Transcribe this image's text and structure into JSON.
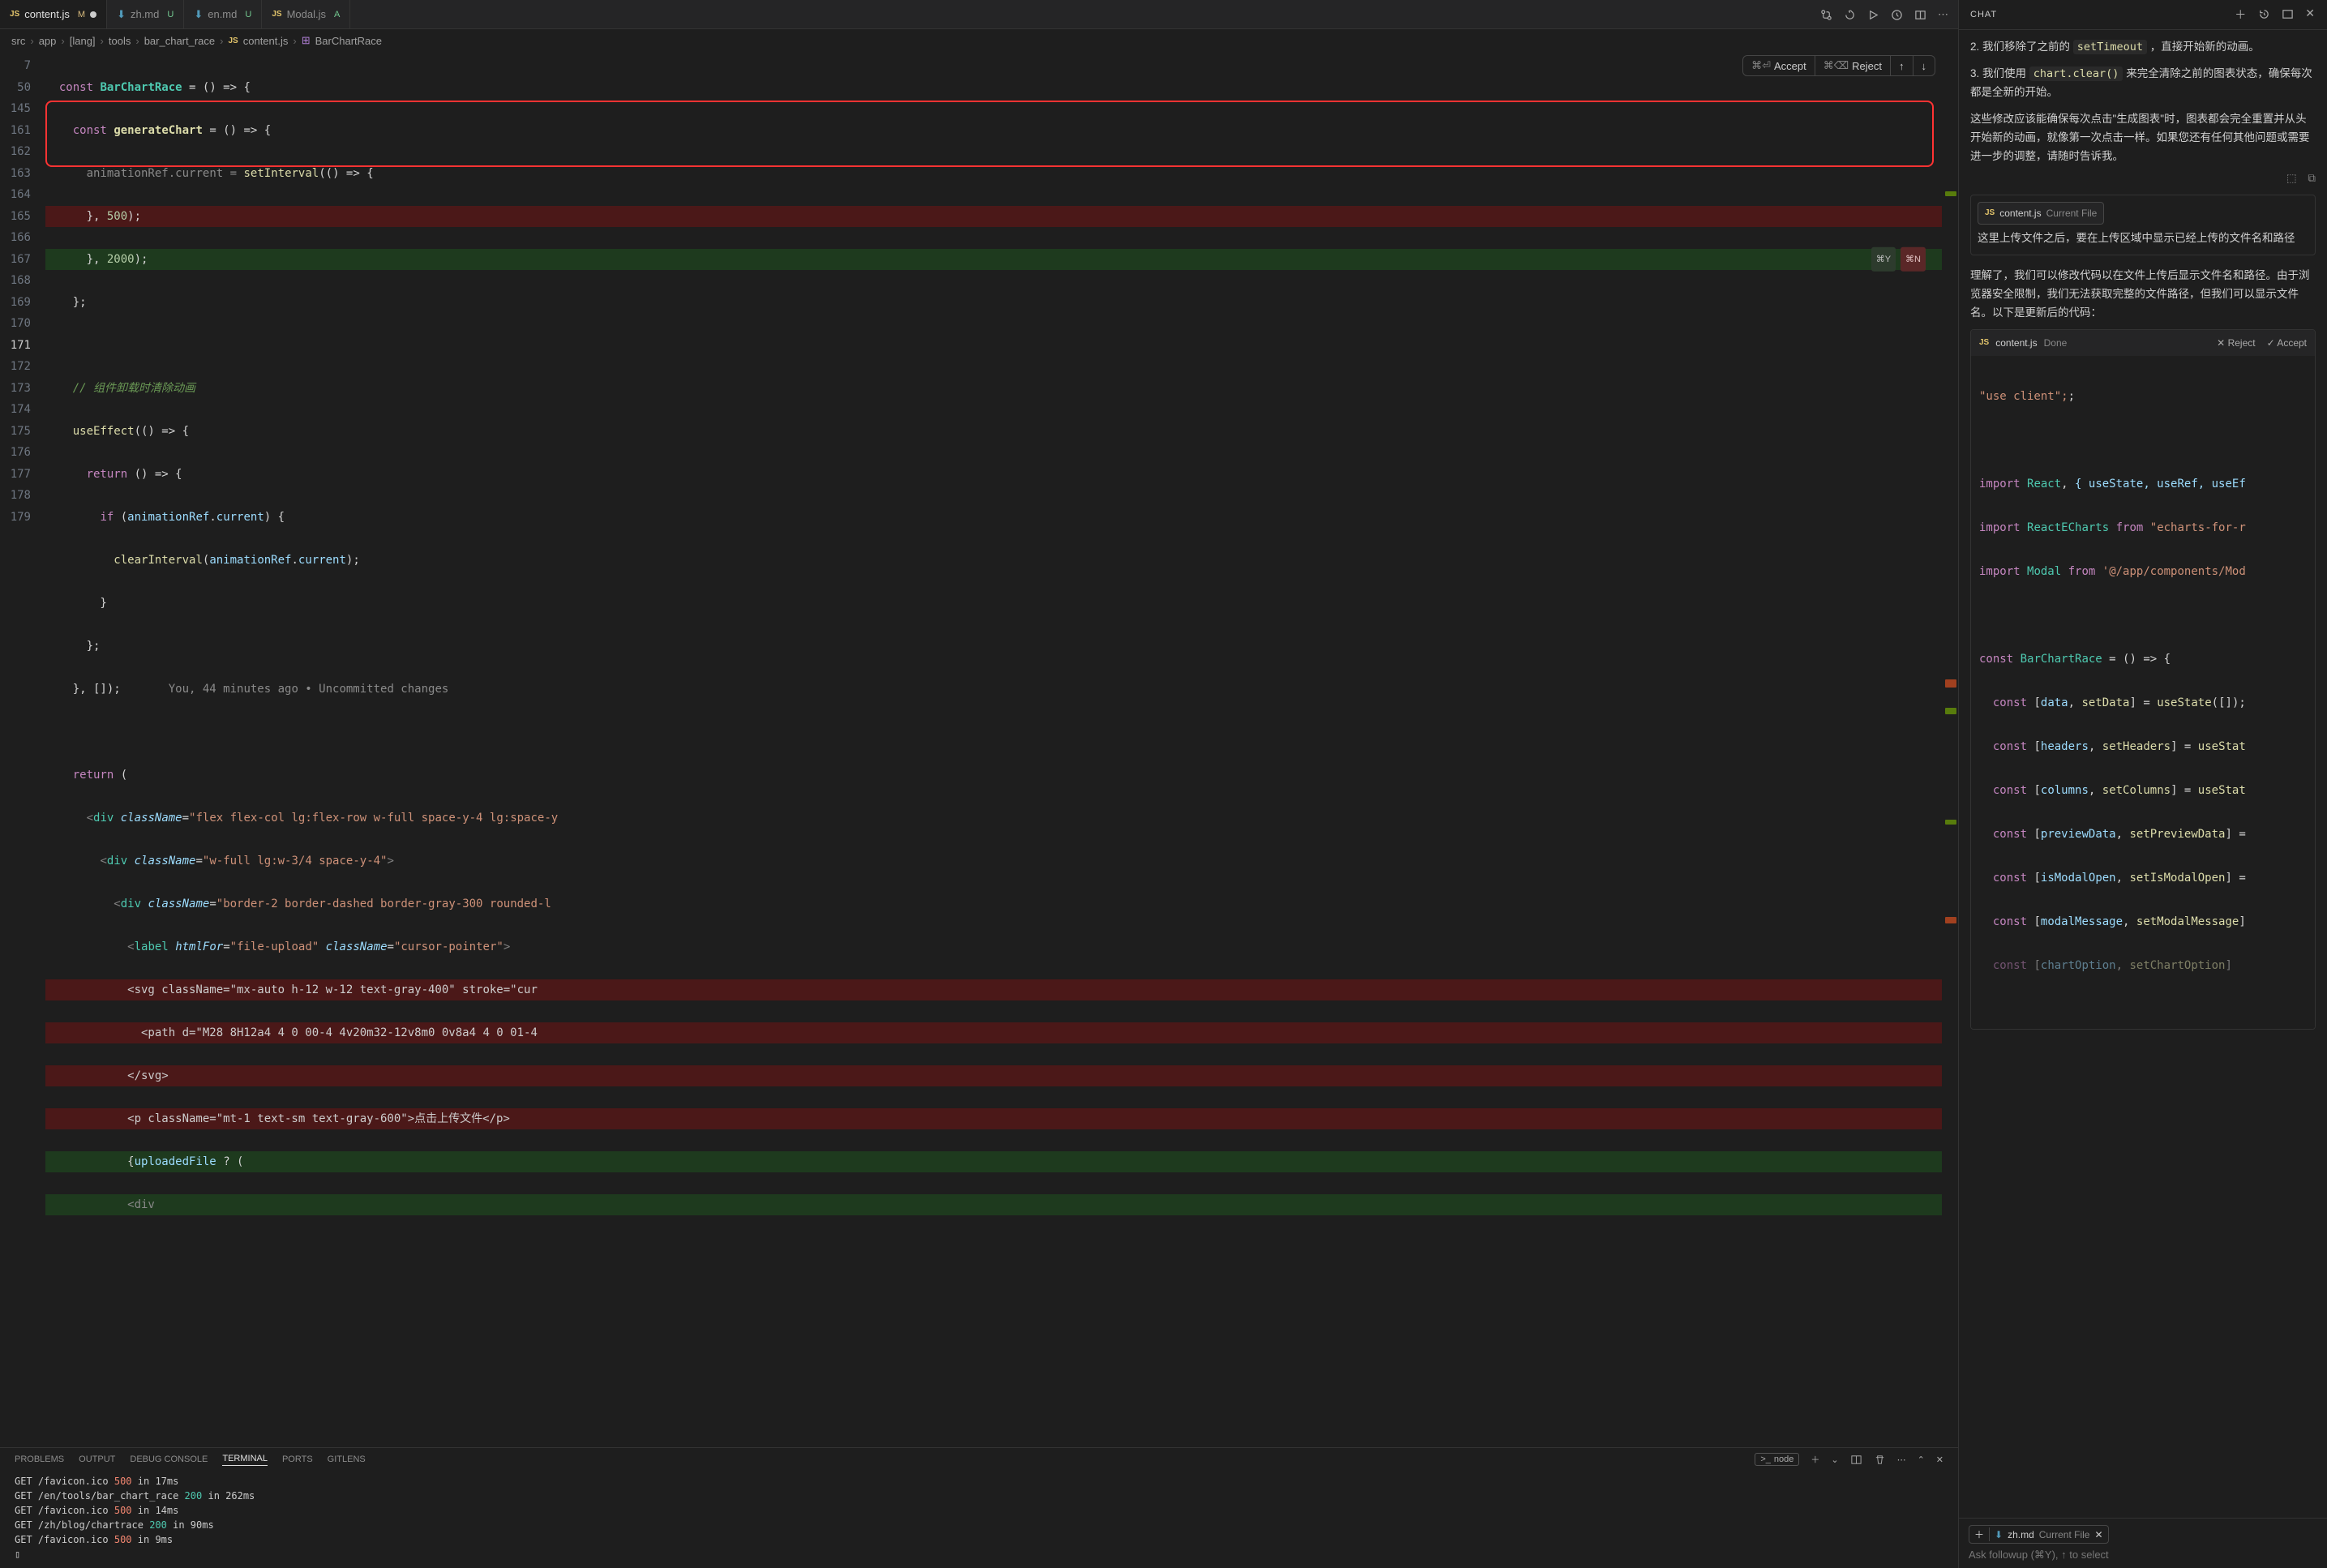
{
  "tabs": [
    {
      "icon": "JS",
      "name": "content.js",
      "status": "M",
      "modified": true,
      "active": true
    },
    {
      "icon": "↓",
      "name": "zh.md",
      "status": "U"
    },
    {
      "icon": "↓",
      "name": "en.md",
      "status": "U"
    },
    {
      "icon": "JS",
      "name": "Modal.js",
      "status": "A"
    }
  ],
  "breadcrumb": [
    "src",
    "app",
    "[lang]",
    "tools",
    "bar_chart_race",
    "content.js",
    "BarChartRace"
  ],
  "breadcrumb_icon_js": "JS",
  "action_bar": {
    "accept": "Accept",
    "reject": "Reject",
    "accept_key": "⌘⏎",
    "reject_key": "⌘⌫"
  },
  "inline_badges": {
    "y": "⌘Y",
    "n": "⌘N"
  },
  "gutter": [
    7,
    50,
    145,
    "",
    161,
    162,
    163,
    164,
    165,
    166,
    167,
    168,
    169,
    170,
    171,
    172,
    173,
    174,
    175,
    176,
    177,
    "",
    "",
    "",
    "",
    "",
    178,
    179
  ],
  "inline_hint": "You, 44 minutes ago • Uncommitted changes",
  "code": {
    "l1_kw": "const",
    "l1_name": "BarChartRace",
    "l1_rest": " = () => {",
    "l2_kw": "const",
    "l2_name": "generateChart",
    "l2_rest": " = () => {",
    "l3_a": "animationRef",
    "l3_b": "current",
    "l3_c": "setInterval",
    "l3_d": "(() => {",
    "l4": "      }, ",
    "l4_num": "500",
    "l4_end": ");",
    "l5": "      }, ",
    "l5_num": "2000",
    "l5_end": ");",
    "l6": "    };",
    "l8_cmt": "// 组件卸载时清除动画",
    "l9_fn": "useEffect",
    "l9_rest": "(() => {",
    "l10_kw": "return",
    "l10_rest": " () => {",
    "l11_kw": "if",
    "l11_a": "animationRef",
    "l11_b": "current",
    "l12_fn": "clearInterval",
    "l12_a": "animationRef",
    "l12_b": "current",
    "l13": "        }",
    "l14": "      };",
    "l15": "    }, []);",
    "l17_kw": "return",
    "l18_attr": "className",
    "l18_val": "\"flex flex-col lg:flex-row w-full space-y-4 lg:space-y",
    "l19_attr": "className",
    "l19_val": "\"w-full lg:w-3/4 space-y-4\"",
    "l20_attr": "className",
    "l20_val": "\"border-2 border-dashed border-gray-300 rounded-l",
    "l21_tag": "label",
    "l21_attr1": "htmlFor",
    "l21_val1": "\"file-upload\"",
    "l21_attr2": "className",
    "l21_val2": "\"cursor-pointer\"",
    "l22": "            <svg className=\"mx-auto h-12 w-12 text-gray-400\" stroke=\"cur",
    "l23": "              <path d=\"M28 8H12a4 4 0 00-4 4v20m32-12v8m0 0v8a4 4 0 01-4 ",
    "l24": "            </svg>",
    "l25": "            <p className=\"mt-1 text-sm text-gray-600\">点击上传文件</p>",
    "l26_a": "uploadedFile",
    "l27": "            <div"
  },
  "panel_tabs": [
    "PROBLEMS",
    "OUTPUT",
    "DEBUG CONSOLE",
    "TERMINAL",
    "PORTS",
    "GITLENS"
  ],
  "panel_active": "TERMINAL",
  "panel_right_node": "node",
  "terminal": [
    {
      "m": "GET",
      "p": "/favicon.ico",
      "s": "500",
      "t": "in 17ms"
    },
    {
      "m": "GET",
      "p": "/en/tools/bar_chart_race",
      "s": "200",
      "t": "in 262ms"
    },
    {
      "m": "GET",
      "p": "/favicon.ico",
      "s": "500",
      "t": "in 14ms"
    },
    {
      "m": "GET",
      "p": "/zh/blog/chartrace",
      "s": "200",
      "t": "in 90ms"
    },
    {
      "m": "GET",
      "p": "/favicon.ico",
      "s": "500",
      "t": "in 9ms"
    }
  ],
  "chat": {
    "header": "CHAT",
    "msg2_pre": "2. 我们移除了之前的 ",
    "msg2_code": "setTimeout",
    "msg2_post": " ，直接开始新的动画。",
    "msg3_pre": "3. 我们使用 ",
    "msg3_code": "chart.clear()",
    "msg3_post": " 来完全清除之前的图表状态，确保每次都是全新的开始。",
    "msg4": "这些修改应该能确保每次点击\"生成图表\"时，图表都会完全重置并从头开始新的动画，就像第一次点击一样。如果您还有任何其他问题或需要进一步的调整，请随时告诉我。",
    "pill1_file": "content.js",
    "pill1_meta": "Current File",
    "user_msg": "这里上传文件之后，要在上传区域中显示已经上传的文件名和路径",
    "reply1": "理解了，我们可以修改代码以在文件上传后显示文件名和路径。由于浏览器安全限制，我们无法获取完整的文件路径，但我们可以显示文件名。以下是更新后的代码：",
    "codebox_file": "content.js",
    "codebox_status": "Done",
    "codebox_reject": "Reject",
    "codebox_accept": "Accept",
    "cb": {
      "l1": "\"use client\";",
      "l2a": "import",
      "l2b": "React",
      "l2c": "{ useState, useRef, useEf",
      "l3a": "import",
      "l3b": "ReactECharts",
      "l3c": "from",
      "l3d": "\"echarts-for-r",
      "l4a": "import",
      "l4b": "Modal",
      "l4c": "from",
      "l4d": "'@/app/components/Mod",
      "l5a": "const",
      "l5b": "BarChartRace",
      "l5c": " = () => {",
      "decl": [
        {
          "a": "data",
          "b": "setData",
          "c": "useState",
          "arg": "[]"
        },
        {
          "a": "headers",
          "b": "setHeaders",
          "c": "useStat"
        },
        {
          "a": "columns",
          "b": "setColumns",
          "c": "useStat"
        },
        {
          "a": "previewData",
          "b": "setPreviewData",
          "c": ""
        },
        {
          "a": "isModalOpen",
          "b": "setIsModalOpen",
          "c": ""
        },
        {
          "a": "modalMessage",
          "b": "setModalMessage",
          "c": ""
        },
        {
          "a": "chartOption",
          "b": "setChartOption",
          "c": ""
        }
      ]
    },
    "input_pill_file": "zh.md",
    "input_pill_meta": "Current File",
    "input_placeholder": "Ask followup (⌘Y), ↑ to select"
  }
}
